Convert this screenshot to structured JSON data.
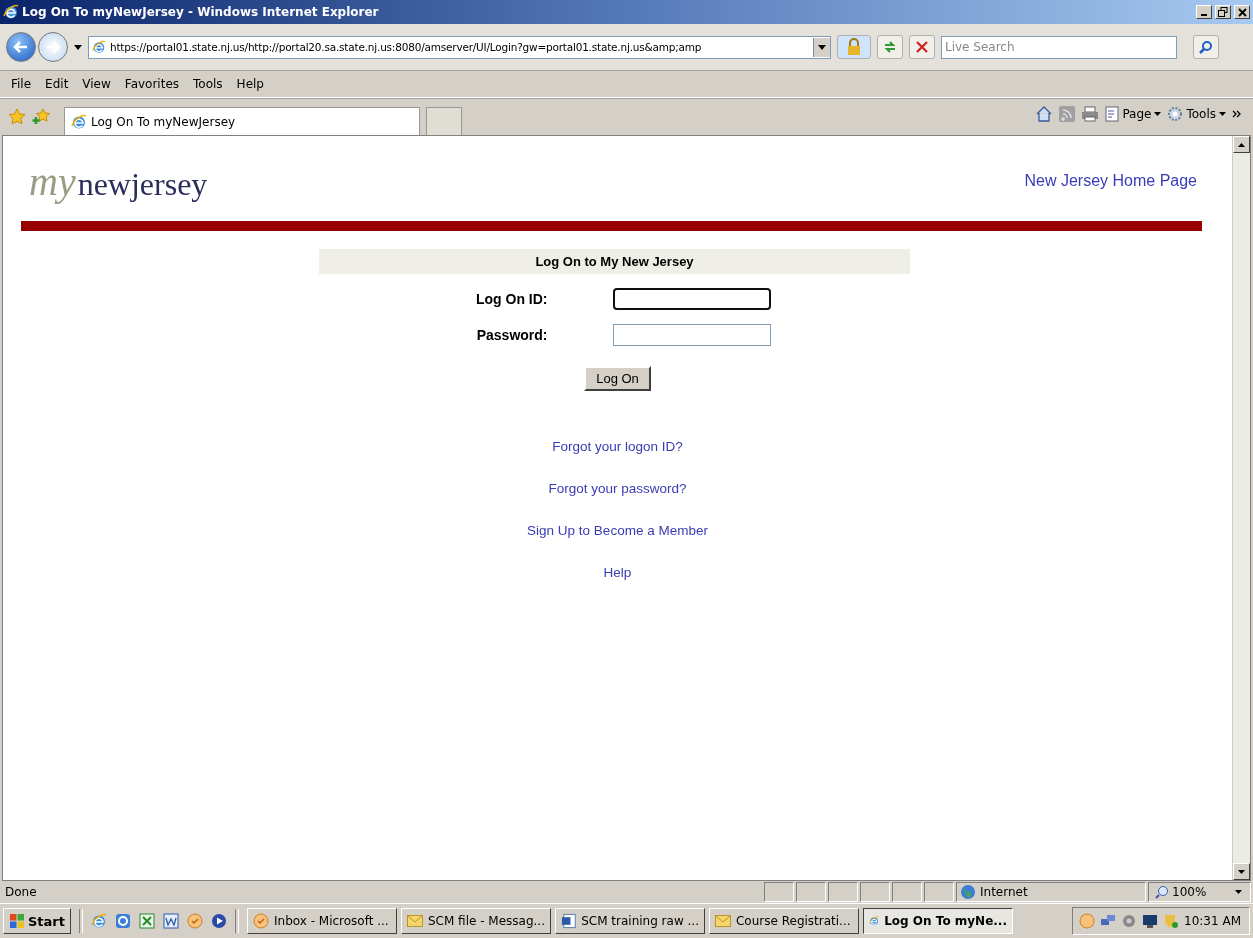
{
  "window": {
    "title": "Log On To myNewJersey - Windows Internet Explorer"
  },
  "address_bar": {
    "url": "https://portal01.state.nj.us/http://portal20.sa.state.nj.us:8080/amserver/UI/Login?gw=portal01.state.nj.us&amp;amp"
  },
  "search": {
    "placeholder": "Live Search"
  },
  "menu": [
    "File",
    "Edit",
    "View",
    "Favorites",
    "Tools",
    "Help"
  ],
  "tabs": [
    {
      "label": "Log On To myNewJersey",
      "selected": true
    }
  ],
  "command_bar": [
    "Page",
    "Tools"
  ],
  "page": {
    "logo": {
      "script": "my",
      "word": "newjersey"
    },
    "home_link": "New Jersey Home Page",
    "form_title": "Log On to My New Jersey",
    "fields": [
      {
        "label": "Log On ID:",
        "focused": true
      },
      {
        "label": "Password:",
        "focused": false
      }
    ],
    "submit": "Log On",
    "links": [
      "Forgot your logon ID?",
      "Forgot your password?",
      "Sign Up to Become a Member",
      "Help"
    ]
  },
  "status_bar": {
    "text": "Done",
    "zone": "Internet",
    "zoom": "100%"
  },
  "taskbar": {
    "start": "Start",
    "tasks": [
      {
        "label": "Inbox - Microsoft ...",
        "kind": "outlook",
        "selected": false
      },
      {
        "label": "SCM file - Messag...",
        "kind": "mail",
        "selected": false
      },
      {
        "label": "SCM training raw ...",
        "kind": "word",
        "selected": false
      },
      {
        "label": "Course Registrati...",
        "kind": "mail",
        "selected": false
      },
      {
        "label": "Log On To myNe...",
        "kind": "ie",
        "selected": true
      }
    ],
    "clock": "10:31 AM"
  }
}
